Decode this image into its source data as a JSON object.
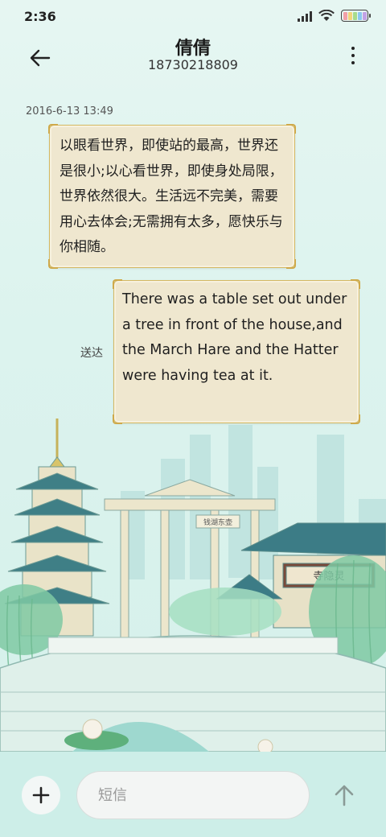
{
  "status_bar": {
    "time": "2:36"
  },
  "header": {
    "contact_name": "倩倩",
    "contact_number": "18730218809"
  },
  "conversation": {
    "timestamp": "2016-6-13 13:49",
    "messages": [
      {
        "direction": "incoming",
        "text": "以眼看世界，即使站的最高，世界还是很小;以心看世界，即使身处局限，世界依然很大。生活远不完美，需要用心去体会;无需拥有太多，愿快乐与你相随。"
      },
      {
        "direction": "outgoing",
        "text": "There was a table set out under a tree in front of the house,and the March Hare and the Hatter were having tea at it.",
        "status": "送达"
      }
    ]
  },
  "scene": {
    "gate_sign": "钱湖东壶",
    "temple_sign": "寺隐灵"
  },
  "composer": {
    "placeholder": "短信"
  },
  "colors": {
    "bubble_bg": "#efe7cf",
    "bubble_border": "#d4b862",
    "background": "#dcf3ee",
    "input_bar": "#cdeee8"
  },
  "icons": [
    "back-arrow-icon",
    "more-vertical-icon",
    "plus-icon",
    "send-arrow-icon",
    "signal-icon",
    "wifi-icon",
    "battery-icon"
  ]
}
